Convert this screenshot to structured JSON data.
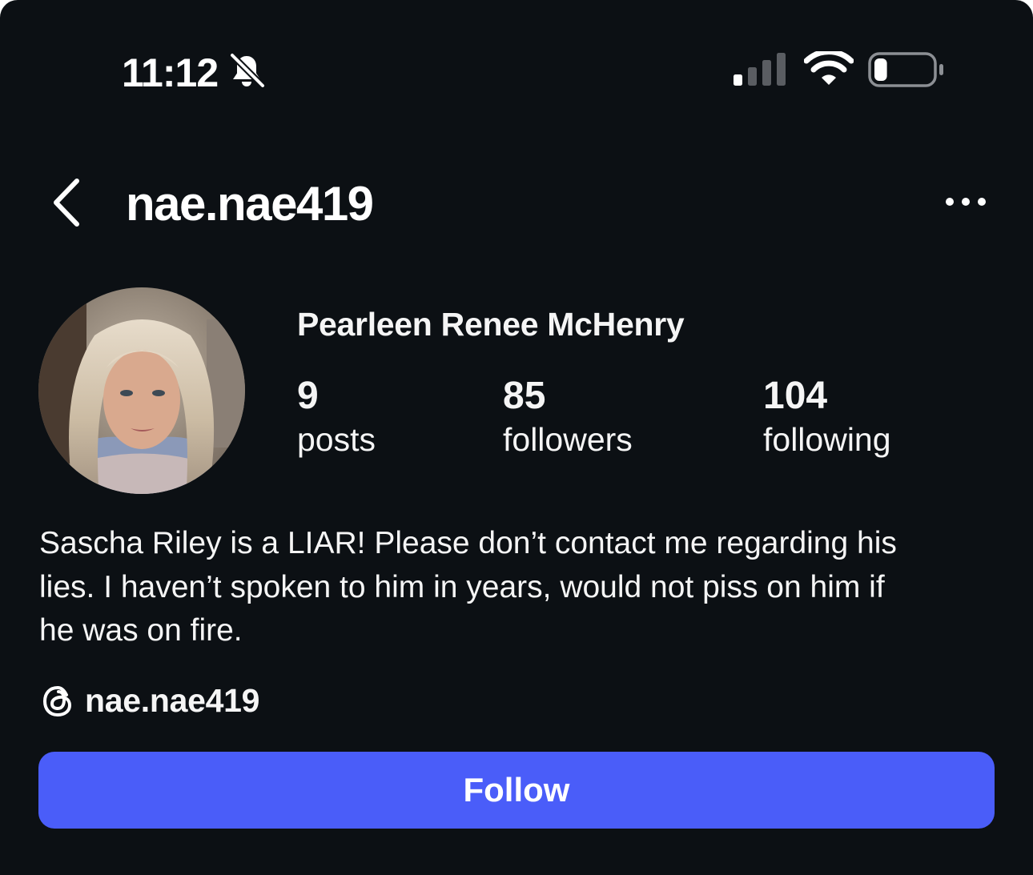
{
  "status_bar": {
    "time": "11:12",
    "silent_icon": "bell-slash-icon",
    "signal_icon": "cellular-signal-icon",
    "wifi_icon": "wifi-icon",
    "battery_icon": "battery-icon",
    "battery_level": 0.18
  },
  "header": {
    "back_icon": "chevron-left-icon",
    "username": "nae.nae419",
    "more_icon": "more-horizontal-icon"
  },
  "profile": {
    "avatar": "profile-photo",
    "full_name": "Pearleen Renee McHenry",
    "stats": [
      {
        "count": "9",
        "label": "posts"
      },
      {
        "count": "85",
        "label": "followers"
      },
      {
        "count": "104",
        "label": "following"
      }
    ],
    "bio": "Sascha Riley is a LIAR! Please don’t contact me regarding his\nlies. I haven’t spoken to him in years, would not piss on him if\nhe was on fire.",
    "threads_icon": "threads-icon",
    "threads_handle": "nae.nae419"
  },
  "actions": {
    "follow_label": "Follow"
  },
  "colors": {
    "background": "#0c1014",
    "text": "#f5f5f5",
    "follow_button": "#4a5df9"
  }
}
